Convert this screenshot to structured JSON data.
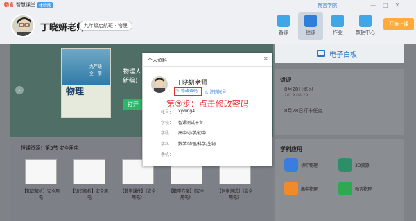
{
  "brand": {
    "logo": "畅言",
    "name": "智慧课堂",
    "tag": "体验版"
  },
  "header": {
    "teacher_name": "丁晓妍老师",
    "class_selected": "九年级启航班 · 物理",
    "links": [
      "畅言学院"
    ],
    "window_controls": [
      "—",
      "□",
      "✕"
    ]
  },
  "nav": {
    "items": [
      {
        "label": "备课"
      },
      {
        "label": "授课"
      },
      {
        "label": "作业"
      },
      {
        "label": "数据中心"
      }
    ],
    "start_class": "开始上课"
  },
  "book": {
    "cover_grade": "九年级",
    "cover_grade2": "全一册",
    "cover_subject": "物理",
    "title_line1": "物理人",
    "title_line2": "新编)",
    "open_button": "打开"
  },
  "whiteboard": {
    "label": "电子白板"
  },
  "lecture": {
    "title": "讲评",
    "items": [
      {
        "date": "8月28日练习",
        "sub": "2019.08.29"
      },
      {
        "date": "8月28日打卡任务",
        "sub": ""
      }
    ]
  },
  "resources": {
    "title": "授课资源：第3节 安全用电",
    "cards": [
      {
        "label": "【知识解析】安全用电"
      },
      {
        "label": "【知识解析】安全用电"
      },
      {
        "label": "【数学课件】《安全用电》"
      },
      {
        "label": "【数学方案】《安全用电》"
      },
      {
        "label": "【同步测试】《安全用电》"
      }
    ]
  },
  "apps": {
    "title": "学科应用",
    "items": [
      {
        "label": "初中物理",
        "color": "#3a7de0"
      },
      {
        "label": "3D资源",
        "color": "#2d8f6a"
      },
      {
        "label": "高中物理",
        "color": "#f08a2a"
      },
      {
        "label": "畅言物理",
        "color": "#2fa84f"
      }
    ]
  },
  "dialog": {
    "title": "个人资料",
    "close": "✕",
    "name": "丁晓妍老师",
    "change_password": "修改密码",
    "logout": "注销帐号",
    "step_note": "第③步：点击修改密码",
    "fields": [
      {
        "label": "帐号：",
        "value": "xyding4"
      },
      {
        "label": "学校：",
        "value": "智课测试平台"
      },
      {
        "label": "学段：",
        "value": "高中/小学/初中"
      },
      {
        "label": "学科：",
        "value": "数学/物理/科学/生物"
      },
      {
        "label": "手机：",
        "value": ""
      }
    ]
  }
}
